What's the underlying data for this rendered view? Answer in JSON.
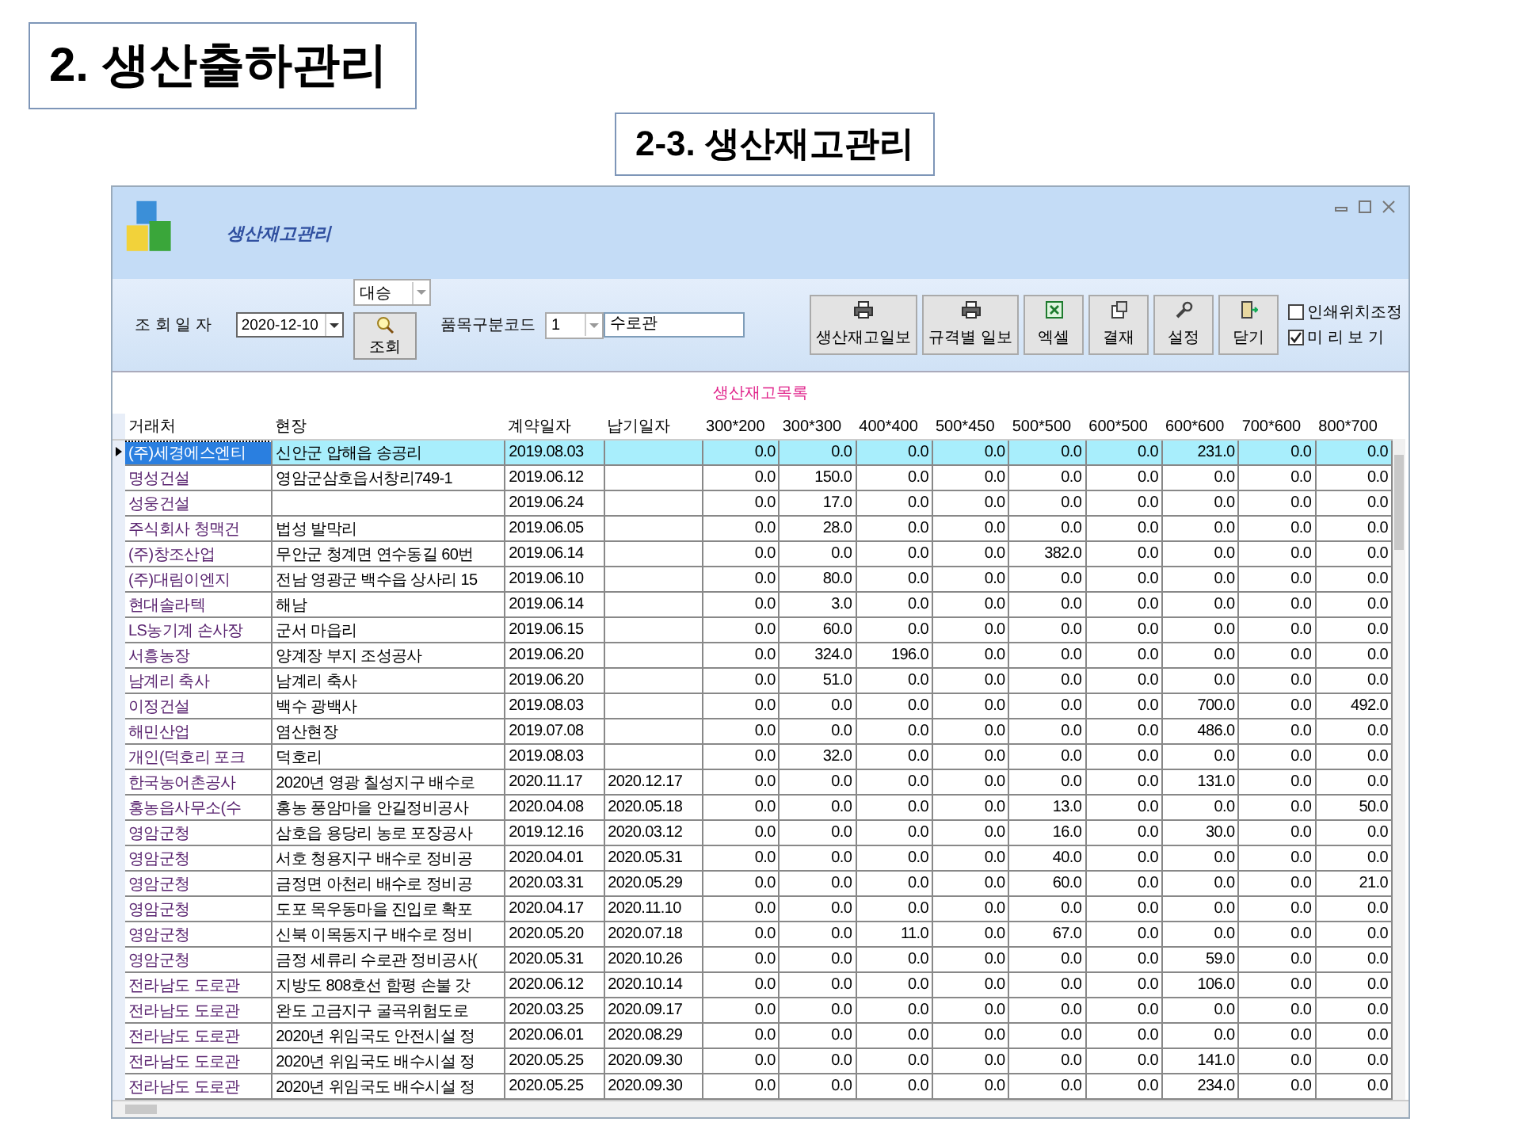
{
  "slide": {
    "title": "2. 생산출하관리",
    "subtitle": "2-3. 생산재고관리"
  },
  "window": {
    "title": "생산재고관리"
  },
  "toolbar": {
    "company_select": {
      "value": "대승"
    },
    "date_label": "조 회 일 자",
    "date_field": {
      "value": "2020-12-10"
    },
    "search_button": "조회",
    "code_label": "품목구분코드",
    "code_select": {
      "value": "1"
    },
    "code_name_field": {
      "value": "수로관"
    },
    "buttons": [
      {
        "label": "생산재고일보",
        "kind": "print"
      },
      {
        "label": "규격별 일보",
        "kind": "print"
      },
      {
        "label": "엑셀",
        "kind": "excel"
      },
      {
        "label": "결재",
        "kind": "approve"
      },
      {
        "label": "설정",
        "kind": "settings"
      },
      {
        "label": "닫기",
        "kind": "exit"
      }
    ],
    "checkboxes": [
      {
        "label": "인쇄위치조정",
        "checked": false
      },
      {
        "label": "미 리 보 기",
        "checked": true
      }
    ]
  },
  "table": {
    "caption": "생산재고목록",
    "columns": [
      "거래처",
      "현장",
      "계약일자",
      "납기일자",
      "300*200",
      "300*300",
      "400*400",
      "500*450",
      "500*500",
      "600*500",
      "600*600",
      "700*600",
      "800*700"
    ],
    "rows": [
      {
        "selected": true,
        "client": "(주)세경에스엔티",
        "site": "신안군 압해읍 송공리",
        "contract": "2019.08.03",
        "values": [
          "0.0",
          "0.0",
          "0.0",
          "0.0",
          "0.0",
          "0.0",
          "231.0",
          "0.0",
          "0.0"
        ]
      },
      {
        "selected": false,
        "client": "명성건설",
        "site": "영암군삼호읍서창리749-1",
        "contract": "2019.06.12",
        "values": [
          "0.0",
          "150.0",
          "0.0",
          "0.0",
          "0.0",
          "0.0",
          "0.0",
          "0.0",
          "0.0"
        ]
      },
      {
        "selected": false,
        "client": "성웅건설",
        "contract": "2019.06.24",
        "values": [
          "0.0",
          "17.0",
          "0.0",
          "0.0",
          "0.0",
          "0.0",
          "0.0",
          "0.0",
          "0.0"
        ]
      },
      {
        "selected": false,
        "client": "주식회사 청맥건",
        "site": "법성 발막리",
        "contract": "2019.06.05",
        "values": [
          "0.0",
          "28.0",
          "0.0",
          "0.0",
          "0.0",
          "0.0",
          "0.0",
          "0.0",
          "0.0"
        ]
      },
      {
        "selected": false,
        "client": "(주)창조산업",
        "site": "무안군 청계면 연수동길 60번",
        "contract": "2019.06.14",
        "values": [
          "0.0",
          "0.0",
          "0.0",
          "0.0",
          "382.0",
          "0.0",
          "0.0",
          "0.0",
          "0.0"
        ]
      },
      {
        "selected": false,
        "client": "(주)대림이엔지",
        "site": "전남 영광군 백수읍 상사리 15",
        "contract": "2019.06.10",
        "values": [
          "0.0",
          "80.0",
          "0.0",
          "0.0",
          "0.0",
          "0.0",
          "0.0",
          "0.0",
          "0.0"
        ]
      },
      {
        "selected": false,
        "client": "현대솔라텍",
        "site": "해남",
        "contract": "2019.06.14",
        "values": [
          "0.0",
          "3.0",
          "0.0",
          "0.0",
          "0.0",
          "0.0",
          "0.0",
          "0.0",
          "0.0"
        ]
      },
      {
        "selected": false,
        "client": "LS농기계 손사장",
        "site": "군서 마읍리",
        "contract": "2019.06.15",
        "values": [
          "0.0",
          "60.0",
          "0.0",
          "0.0",
          "0.0",
          "0.0",
          "0.0",
          "0.0",
          "0.0"
        ]
      },
      {
        "selected": false,
        "client": "서흥농장",
        "site": "양계장 부지 조성공사",
        "contract": "2019.06.20",
        "values": [
          "0.0",
          "324.0",
          "196.0",
          "0.0",
          "0.0",
          "0.0",
          "0.0",
          "0.0",
          "0.0"
        ]
      },
      {
        "selected": false,
        "client": "남계리 축사",
        "site": "남계리 축사",
        "contract": "2019.06.20",
        "values": [
          "0.0",
          "51.0",
          "0.0",
          "0.0",
          "0.0",
          "0.0",
          "0.0",
          "0.0",
          "0.0"
        ]
      },
      {
        "selected": false,
        "client": "이정건설",
        "site": "백수 광백사",
        "contract": "2019.08.03",
        "values": [
          "0.0",
          "0.0",
          "0.0",
          "0.0",
          "0.0",
          "0.0",
          "700.0",
          "0.0",
          "492.0"
        ]
      },
      {
        "selected": false,
        "client": "해민산업",
        "site": "염산현장",
        "contract": "2019.07.08",
        "values": [
          "0.0",
          "0.0",
          "0.0",
          "0.0",
          "0.0",
          "0.0",
          "486.0",
          "0.0",
          "0.0"
        ]
      },
      {
        "selected": false,
        "client": "개인(덕호리 포크",
        "site": "덕호리",
        "contract": "2019.08.03",
        "values": [
          "0.0",
          "32.0",
          "0.0",
          "0.0",
          "0.0",
          "0.0",
          "0.0",
          "0.0",
          "0.0"
        ]
      },
      {
        "selected": false,
        "client": "한국농어촌공사",
        "site": "2020년 영광 칠성지구 배수로",
        "contract": "2020.11.17",
        "due": "2020.12.17",
        "values": [
          "0.0",
          "0.0",
          "0.0",
          "0.0",
          "0.0",
          "0.0",
          "131.0",
          "0.0",
          "0.0"
        ]
      },
      {
        "selected": false,
        "client": "홍농읍사무소(수",
        "site": "홍농 풍암마을 안길정비공사",
        "contract": "2020.04.08",
        "due": "2020.05.18",
        "values": [
          "0.0",
          "0.0",
          "0.0",
          "0.0",
          "13.0",
          "0.0",
          "0.0",
          "0.0",
          "50.0"
        ]
      },
      {
        "selected": false,
        "client": "영암군청",
        "site": "삼호읍 용당리 농로 포장공사",
        "contract": "2019.12.16",
        "due": "2020.03.12",
        "values": [
          "0.0",
          "0.0",
          "0.0",
          "0.0",
          "16.0",
          "0.0",
          "30.0",
          "0.0",
          "0.0"
        ]
      },
      {
        "selected": false,
        "client": "영암군청",
        "site": "서호 청용지구 배수로 정비공",
        "contract": "2020.04.01",
        "due": "2020.05.31",
        "values": [
          "0.0",
          "0.0",
          "0.0",
          "0.0",
          "40.0",
          "0.0",
          "0.0",
          "0.0",
          "0.0"
        ]
      },
      {
        "selected": false,
        "client": "영암군청",
        "site": "금정면 아천리 배수로 정비공",
        "contract": "2020.03.31",
        "due": "2020.05.29",
        "values": [
          "0.0",
          "0.0",
          "0.0",
          "0.0",
          "60.0",
          "0.0",
          "0.0",
          "0.0",
          "21.0"
        ]
      },
      {
        "selected": false,
        "client": "영암군청",
        "site": "도포 목우동마을 진입로 확포",
        "contract": "2020.04.17",
        "due": "2020.11.10",
        "values": [
          "0.0",
          "0.0",
          "0.0",
          "0.0",
          "0.0",
          "0.0",
          "0.0",
          "0.0",
          "0.0"
        ]
      },
      {
        "selected": false,
        "client": "영암군청",
        "site": "신북 이목동지구 배수로 정비",
        "contract": "2020.05.20",
        "due": "2020.07.18",
        "values": [
          "0.0",
          "0.0",
          "11.0",
          "0.0",
          "67.0",
          "0.0",
          "0.0",
          "0.0",
          "0.0"
        ]
      },
      {
        "selected": false,
        "client": "영암군청",
        "site": "금정 세류리 수로관 정비공사(",
        "contract": "2020.05.31",
        "due": "2020.10.26",
        "values": [
          "0.0",
          "0.0",
          "0.0",
          "0.0",
          "0.0",
          "0.0",
          "59.0",
          "0.0",
          "0.0"
        ]
      },
      {
        "selected": false,
        "client": "전라남도 도로관",
        "site": "지방도 808호선 함평 손불 갓",
        "contract": "2020.06.12",
        "due": "2020.10.14",
        "values": [
          "0.0",
          "0.0",
          "0.0",
          "0.0",
          "0.0",
          "0.0",
          "106.0",
          "0.0",
          "0.0"
        ]
      },
      {
        "selected": false,
        "client": "전라남도 도로관",
        "site": "완도 고금지구 굴곡위험도로",
        "contract": "2020.03.25",
        "due": "2020.09.17",
        "values": [
          "0.0",
          "0.0",
          "0.0",
          "0.0",
          "0.0",
          "0.0",
          "0.0",
          "0.0",
          "0.0"
        ]
      },
      {
        "selected": false,
        "client": "전라남도 도로관",
        "site": "2020년 위임국도 안전시설 정",
        "contract": "2020.06.01",
        "due": "2020.08.29",
        "values": [
          "0.0",
          "0.0",
          "0.0",
          "0.0",
          "0.0",
          "0.0",
          "0.0",
          "0.0",
          "0.0"
        ]
      },
      {
        "selected": false,
        "client": "전라남도 도로관",
        "site": "2020년 위임국도 배수시설 정",
        "contract": "2020.05.25",
        "due": "2020.09.30",
        "values": [
          "0.0",
          "0.0",
          "0.0",
          "0.0",
          "0.0",
          "0.0",
          "141.0",
          "0.0",
          "0.0"
        ]
      },
      {
        "selected": false,
        "client": "전라남도 도로관",
        "site": "2020년 위임국도 배수시설 정",
        "contract": "2020.05.25",
        "due": "2020.09.30",
        "values": [
          "0.0",
          "0.0",
          "0.0",
          "0.0",
          "0.0",
          "0.0",
          "234.0",
          "0.0",
          "0.0"
        ]
      }
    ]
  }
}
